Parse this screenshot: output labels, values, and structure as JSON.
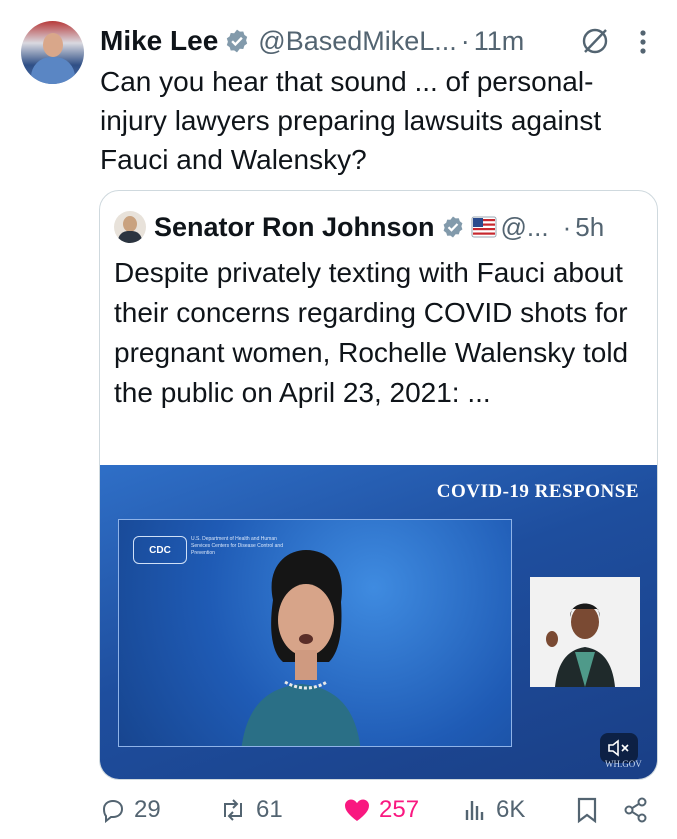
{
  "tweet": {
    "author_name": "Mike Lee",
    "handle": "@BasedMikeL...",
    "separator": "·",
    "time": "11m",
    "text": "Can you hear that sound ... of personal-injury lawyers preparing lawsuits against Fauci and Walensky?"
  },
  "quoted": {
    "author_name": "Senator Ron Johnson",
    "handle": "@...",
    "separator": "·",
    "time": "5h",
    "text": "Despite privately texting with Fauci about their concerns regarding COVID shots for pregnant women, Rochelle Walensky told the public on April 23, 2021: ...",
    "video": {
      "title": "COVID-19 RESPONSE",
      "logo": "CDC",
      "org_lines": "U.S. Department of Health and Human Services Centers for Disease Control and Prevention",
      "watermark": "WH.GOV"
    }
  },
  "actions": {
    "replies": "29",
    "reposts": "61",
    "likes": "257",
    "views": "6K"
  },
  "colors": {
    "text": "#0f1419",
    "secondary": "#536471",
    "verified": "#829aab",
    "like": "#f91880",
    "border": "#cfd9de"
  },
  "icons": [
    "verified-badge-icon",
    "grok-icon",
    "more-icon",
    "flag-icon",
    "reply-icon",
    "repost-icon",
    "heart-icon",
    "views-icon",
    "bookmark-icon",
    "share-icon",
    "mute-icon"
  ]
}
